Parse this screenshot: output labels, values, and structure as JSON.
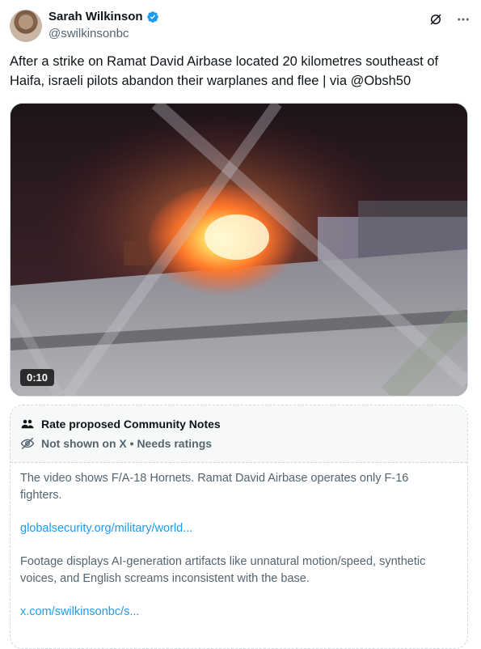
{
  "author": {
    "display_name": "Sarah Wilkinson",
    "handle": "@swilkinsonbc",
    "verified_icon": "verified-badge-icon",
    "avatar_icon": "avatar"
  },
  "header_actions": [
    {
      "icon": "grok-icon"
    },
    {
      "icon": "more-icon",
      "label": "···"
    }
  ],
  "tweet": {
    "text": "After a strike on Ramat David Airbase located 20 kilometres southeast of Haifa, israeli pilots abandon their warplanes and flee | via @Obsh50"
  },
  "media": {
    "duration": "0:10"
  },
  "community_notes": {
    "title": "Rate proposed Community Notes",
    "status": "Not shown on X • Needs ratings",
    "notes": [
      {
        "text": "The video shows F/A-18 Hornets. Ramat David Airbase operates only F-16 fighters.",
        "link": "globalsecurity.org/military/world..."
      },
      {
        "text": "Footage displays AI-generation artifacts like unnatural motion/speed, synthetic voices, and English screams inconsistent with the base.",
        "link": "x.com/swilkinsonbc/s..."
      }
    ]
  },
  "colors": {
    "accent": "#1d9bf0",
    "text_primary": "#0f1419",
    "text_secondary": "#536471",
    "border": "#cfd9de"
  }
}
